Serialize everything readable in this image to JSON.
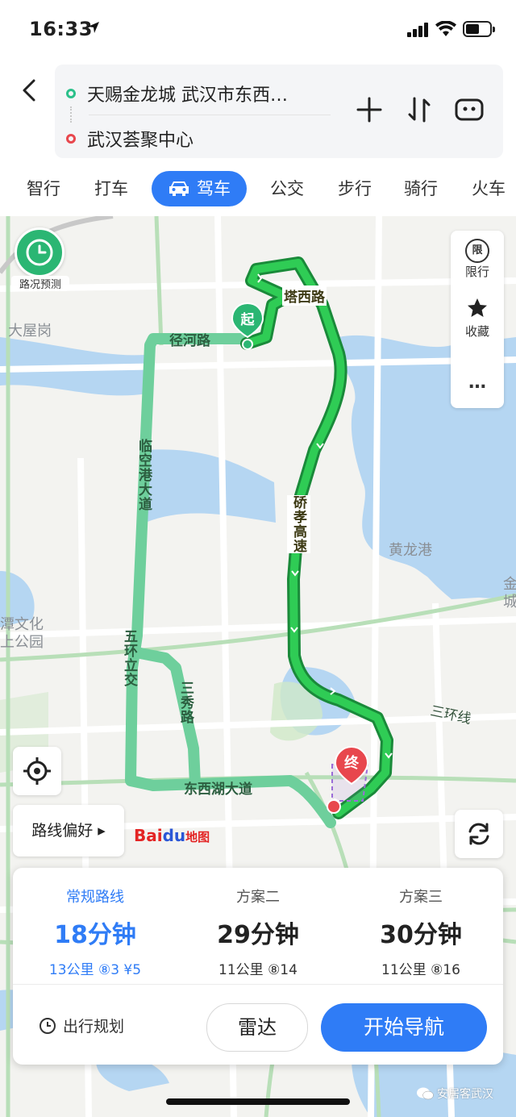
{
  "status_bar": {
    "time": "16:33"
  },
  "route": {
    "origin": "天赐金龙城 武汉市东西…",
    "destination": "武汉荟聚中心"
  },
  "tabs": [
    "智行",
    "打车",
    "驾车",
    "公交",
    "步行",
    "骑行",
    "火车"
  ],
  "active_tab": "驾车",
  "map": {
    "traffic_forecast": "路况预测",
    "side_panel": {
      "restriction_icon": "限",
      "restriction": "限行",
      "favorite": "收藏",
      "more": "…"
    },
    "start_marker": "起",
    "end_marker": "终",
    "place_labels": {
      "daxiagang": "大屋岗",
      "huanglonggang": "黄龙港",
      "culture_park": "潭文化\n上公园",
      "jin_cheng": "金\n城"
    },
    "road_labels": {
      "jinghe": "径河路",
      "taxi": "塔西路",
      "linkonggang": "临空港大道",
      "hanxiao": "硚孝高速",
      "wuhuan": "五环立交",
      "sanhuan_road": "三环线",
      "sanxiu": "三秀路",
      "dongxihu": "东西湖大道"
    },
    "route_preference": "路线偏好 ▸",
    "logo": {
      "bai": "Bai",
      "du": "du",
      "ditu": "地图"
    }
  },
  "plans": [
    {
      "name": "常规路线",
      "duration": "18分钟",
      "meta": "13公里 ⑧3 ¥5"
    },
    {
      "name": "方案二",
      "duration": "29分钟",
      "meta": "11公里 ⑧14"
    },
    {
      "name": "方案三",
      "duration": "30分钟",
      "meta": "11公里 ⑧16"
    }
  ],
  "actions": {
    "trip_plan": "出行规划",
    "radar": "雷达",
    "start_nav": "开始导航"
  },
  "watermark": "安居客武汉",
  "colors": {
    "accent": "#2f7cf6",
    "route_main": "#22b14c",
    "route_alt": "#6ecf9c",
    "water": "#b5d6f2"
  }
}
